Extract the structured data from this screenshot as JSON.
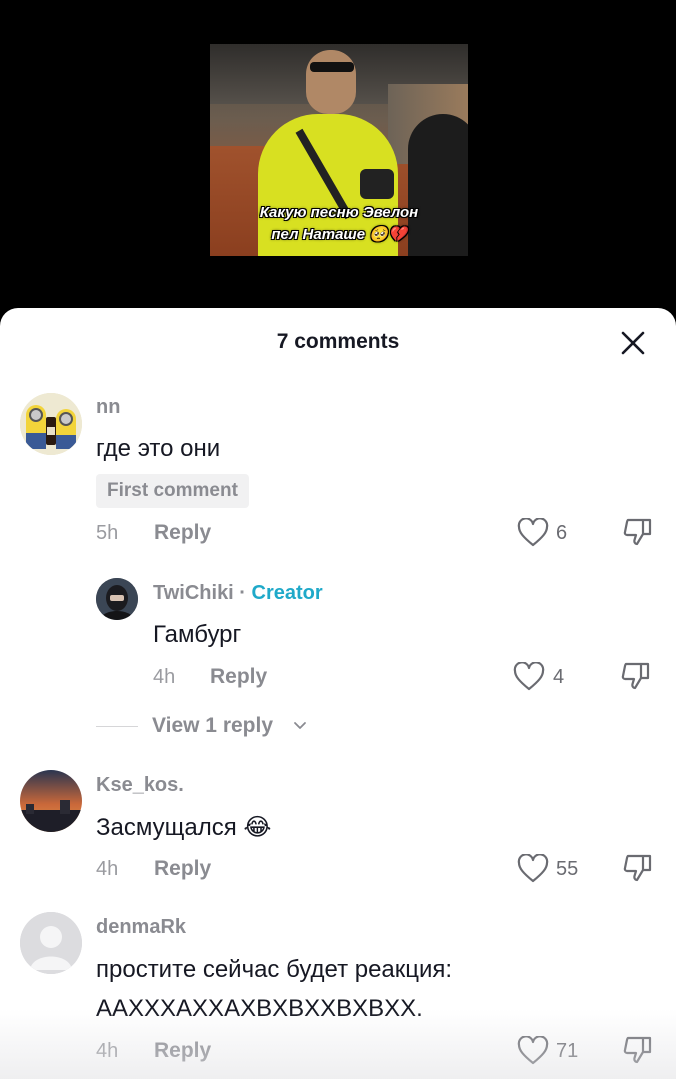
{
  "video": {
    "caption": "Какую песню Эвелон\nпел Наташе 🥺💔"
  },
  "sheet": {
    "title": "7 comments"
  },
  "comments": [
    {
      "username": "nn",
      "text": "где это они",
      "badge": "First comment",
      "time": "5h",
      "reply_label": "Reply",
      "likes": "6"
    },
    {
      "username": "TwiChiki",
      "separator": " · ",
      "creator_label": "Creator",
      "text": "Гамбург",
      "time": "4h",
      "reply_label": "Reply",
      "likes": "4"
    },
    {
      "username": "Kse_kos.",
      "text": "Засмущался 😂",
      "time": "4h",
      "reply_label": "Reply",
      "likes": "55"
    },
    {
      "username": "denmaRk",
      "text_line1": "простите сейчас будет реакция:",
      "text_line2": "AAXXXAXXAXBXBXXBXBXX.",
      "time": "4h",
      "reply_label": "Reply",
      "likes": "71"
    }
  ],
  "view_replies": {
    "label": "View 1 reply"
  },
  "icons": {
    "close": "close-icon",
    "like": "heart-outline-icon",
    "dislike": "thumbs-down-icon",
    "chevron": "chevron-down-icon"
  },
  "colors": {
    "creator": "#1fa9c9",
    "muted": "#8a8b91",
    "text": "#161823"
  }
}
